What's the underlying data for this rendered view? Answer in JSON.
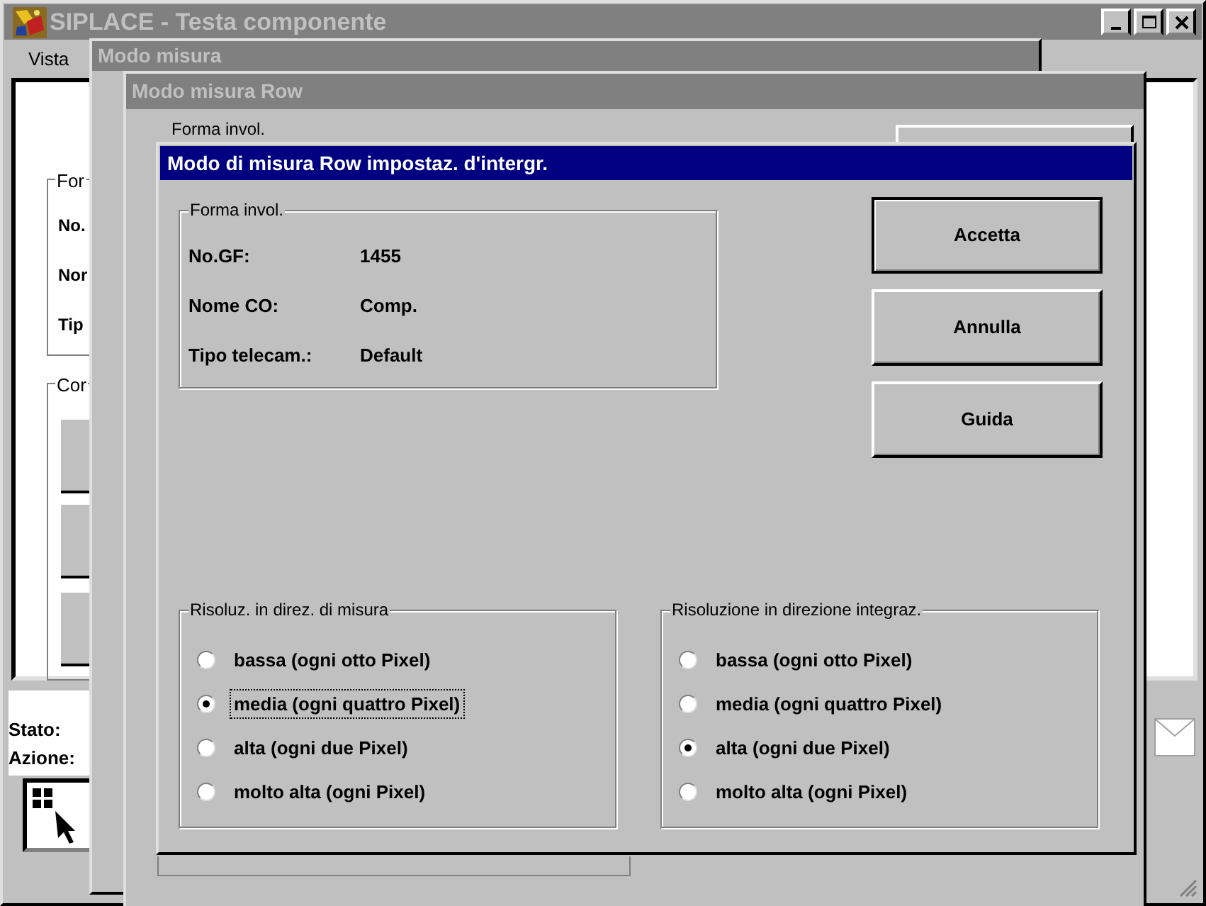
{
  "main_window": {
    "title": "SIPLACE - Testa componente",
    "menu": [
      "Vista"
    ],
    "group_fragments": [
      "For",
      "Cor"
    ],
    "label_fragments": [
      "No.",
      "Nor",
      "Tip"
    ],
    "status_labels": [
      "Stato:",
      "Azione:"
    ]
  },
  "back_windows": [
    {
      "title": "Modo misura"
    },
    {
      "title": "Modo misura Row",
      "group_title": "Forma invol."
    }
  ],
  "dialog": {
    "title": "Modo di misura Row impostaz. d'intergr.",
    "info_group": {
      "title": "Forma invol.",
      "rows": [
        {
          "label": "No.GF:",
          "value": "1455"
        },
        {
          "label": "Nome CO:",
          "value": "Comp."
        },
        {
          "label": "Tipo telecam.:",
          "value": "Default"
        }
      ]
    },
    "buttons": [
      {
        "label": "Accetta",
        "default": true
      },
      {
        "label": "Annulla",
        "default": false
      },
      {
        "label": "Guida",
        "default": false
      }
    ],
    "radio_groups": [
      {
        "title": "Risoluz. in direz. di misura",
        "options": [
          {
            "label": "bassa (ogni otto Pixel)",
            "selected": false,
            "focused": false
          },
          {
            "label": "media (ogni quattro Pixel)",
            "selected": true,
            "focused": true
          },
          {
            "label": "alta (ogni due Pixel)",
            "selected": false,
            "focused": false
          },
          {
            "label": "molto alta (ogni Pixel)",
            "selected": false,
            "focused": false
          }
        ]
      },
      {
        "title": "Risoluzione in direzione integraz.",
        "options": [
          {
            "label": "bassa (ogni otto Pixel)",
            "selected": false,
            "focused": false
          },
          {
            "label": "media (ogni quattro Pixel)",
            "selected": false,
            "focused": false
          },
          {
            "label": "alta (ogni due Pixel)",
            "selected": true,
            "focused": false
          },
          {
            "label": "molto alta (ogni Pixel)",
            "selected": false,
            "focused": false
          }
        ]
      }
    ]
  }
}
